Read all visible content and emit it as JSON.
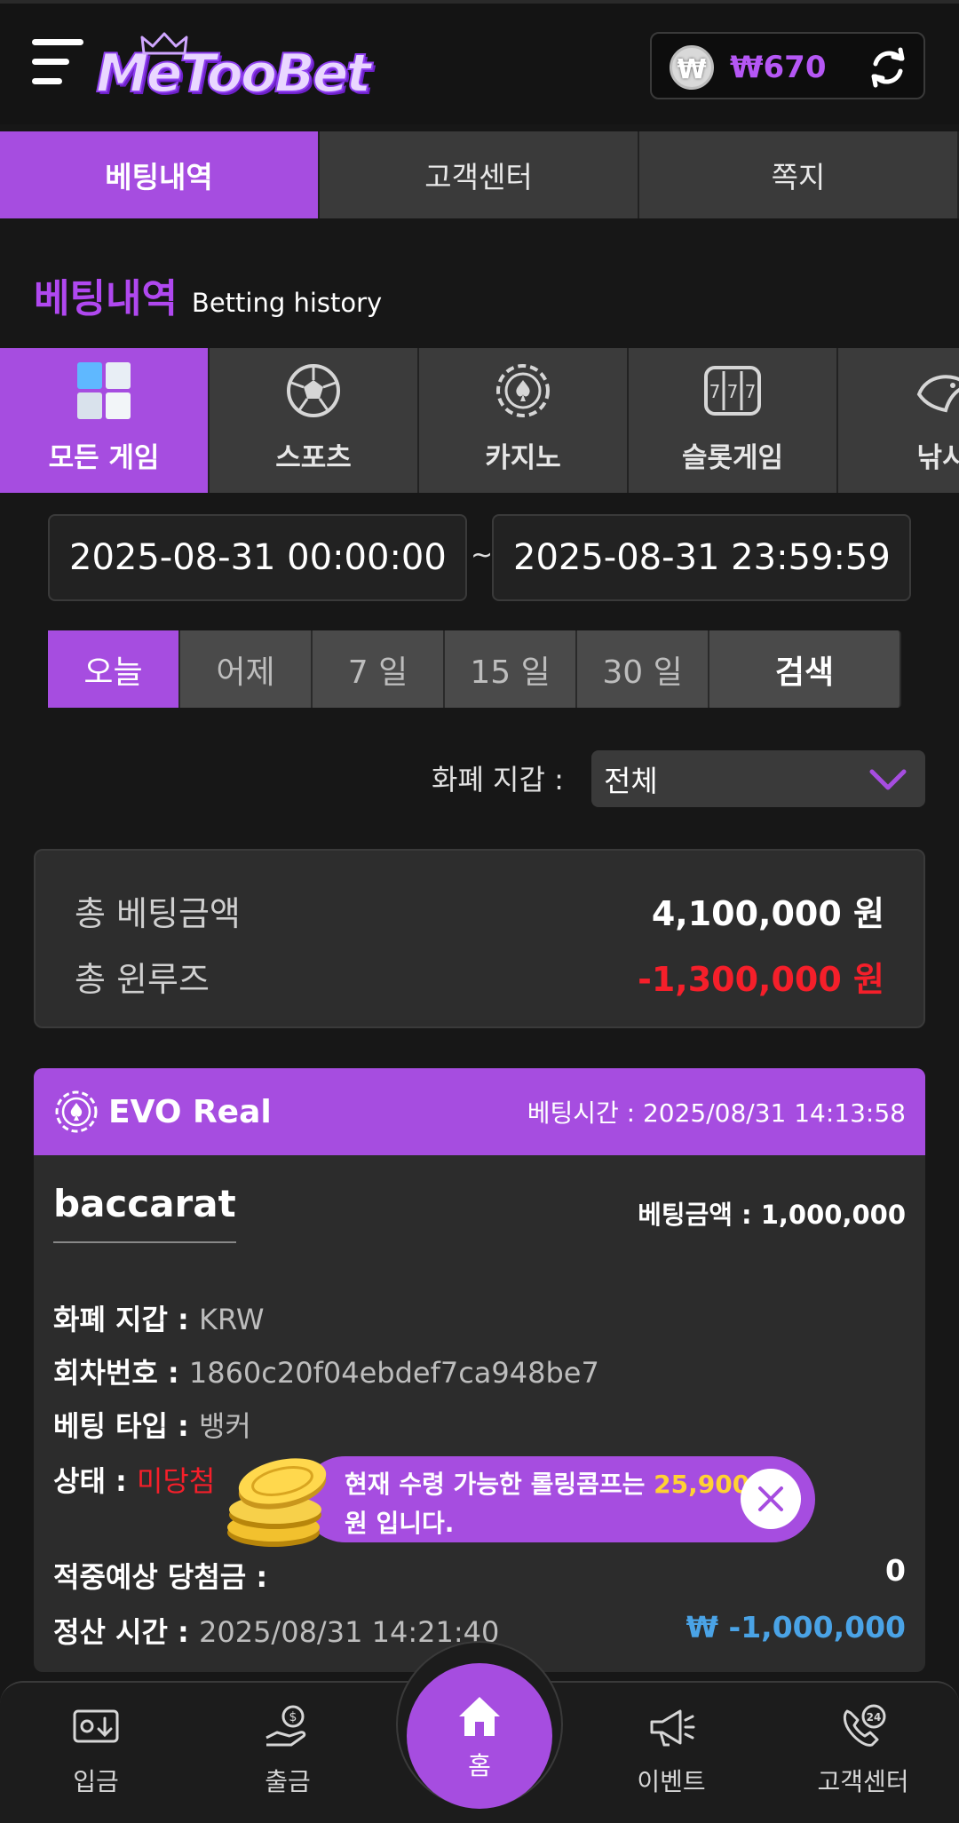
{
  "header": {
    "logo_text": "MeTooBet",
    "currency_symbol": "₩",
    "balance": "₩670"
  },
  "top_tabs": [
    {
      "label": "베팅내역",
      "active": true
    },
    {
      "label": "고객센터",
      "active": false
    },
    {
      "label": "쪽지",
      "active": false
    }
  ],
  "title": {
    "ko": "베팅내역",
    "en": "Betting history"
  },
  "categories": [
    {
      "label": "모든 게임",
      "icon": "all-games-icon",
      "active": true
    },
    {
      "label": "스포츠",
      "icon": "soccer-ball-icon",
      "active": false
    },
    {
      "label": "카지노",
      "icon": "casino-chip-icon",
      "active": false
    },
    {
      "label": "슬롯게임",
      "icon": "slot-777-icon",
      "active": false
    },
    {
      "label": "낚시",
      "icon": "fish-icon",
      "active": false
    }
  ],
  "date_range": {
    "start": "2025-08-31 00:00:00",
    "separator": "~",
    "end": "2025-08-31 23:59:59"
  },
  "quick_dates": [
    {
      "label": "오늘",
      "active": true
    },
    {
      "label": "어제",
      "active": false
    },
    {
      "label": "7 일",
      "active": false
    },
    {
      "label": "15 일",
      "active": false
    },
    {
      "label": "30 일",
      "active": false
    }
  ],
  "search_label": "검색",
  "currency_filter": {
    "label": "화폐 지갑 :",
    "value": "전체"
  },
  "summary": {
    "total_bet_label": "총 베팅금액",
    "total_bet_value": "4,100,000 원",
    "total_winloss_label": "총 윈루즈",
    "total_winloss_value": "-1,300,000 원"
  },
  "bet": {
    "provider": "EVO Real",
    "bet_time": "베팅시간 : 2025/08/31 14:13:58",
    "game": "baccarat",
    "bet_amount": "베팅금액 : 1,000,000",
    "currency_label": "화폐 지갑 : ",
    "currency_value": "KRW",
    "round_label": "회차번호 : ",
    "round_value": "1860c20f04ebdef7ca948be7",
    "bet_type_label": "베팅 타입 : ",
    "bet_type_value": "뱅커",
    "status_label": "상태 : ",
    "status_value": "미당첨",
    "expected_label": "적중예상 당첨금 :",
    "expected_value": "0",
    "settle_label": "정산 시간 : ",
    "settle_value": "2025/08/31 14:21:40",
    "settle_amount": "₩ -1,000,000"
  },
  "rolling_popup": {
    "line1_prefix": "현재 수령 가능한 롤링콤프는 ",
    "amount": "25,900",
    "line2": "원 입니다."
  },
  "bottom_nav": [
    {
      "label": "입금",
      "icon": "deposit-icon"
    },
    {
      "label": "출금",
      "icon": "withdraw-icon"
    },
    {
      "label": "홈",
      "icon": "home-icon"
    },
    {
      "label": "이벤트",
      "icon": "megaphone-icon"
    },
    {
      "label": "고객센터",
      "icon": "support-24-icon"
    }
  ],
  "colors": {
    "accent": "#a64de0",
    "negative": "#f51f2a",
    "settle_blue": "#4aa3e6",
    "gold": "#ffd233"
  }
}
